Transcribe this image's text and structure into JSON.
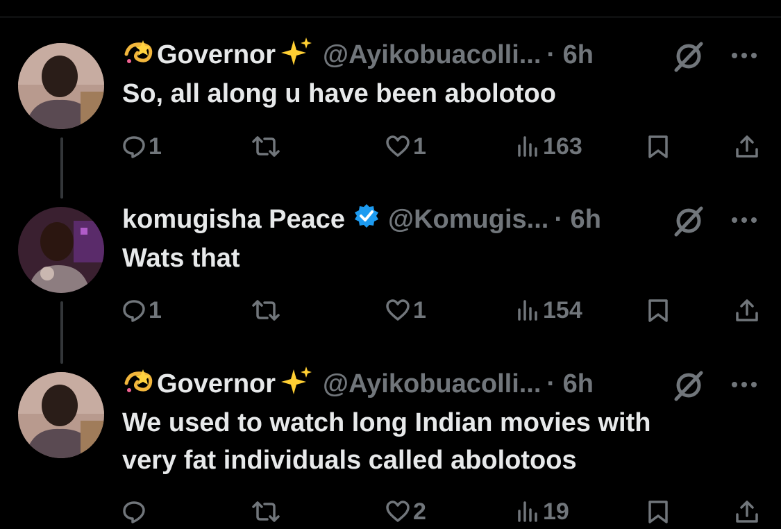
{
  "thread": [
    {
      "author": {
        "name": "Governor",
        "name_prefix_emoji": "dizzy-icon",
        "name_suffix_emoji": "sparkles-icon",
        "handle": "@Ayikobuacolli...",
        "time": "· 6h",
        "verified": false
      },
      "text": "So, all along u have been abolotoo",
      "actions": {
        "replies": "1",
        "reposts": "",
        "likes": "1",
        "views": "163"
      }
    },
    {
      "author": {
        "name": "komugisha Peace",
        "handle": "@Komugis...",
        "time": "· 6h",
        "verified": true
      },
      "text": "Wats that",
      "actions": {
        "replies": "1",
        "reposts": "",
        "likes": "1",
        "views": "154"
      }
    },
    {
      "author": {
        "name": "Governor",
        "name_prefix_emoji": "dizzy-icon",
        "name_suffix_emoji": "sparkles-icon",
        "handle": "@Ayikobuacolli...",
        "time": "· 6h",
        "verified": false
      },
      "text_lines": [
        "We used to watch long Indian movies with",
        "very fat individuals called abolotoos"
      ],
      "actions": {
        "replies": "",
        "reposts": "",
        "likes": "2",
        "views": "19"
      }
    }
  ],
  "colors": {
    "background": "#000000",
    "primary_text": "#e7e9ea",
    "secondary_text": "#71767b",
    "verified_badge": "#1d9bf0",
    "thread_line": "#333639"
  }
}
